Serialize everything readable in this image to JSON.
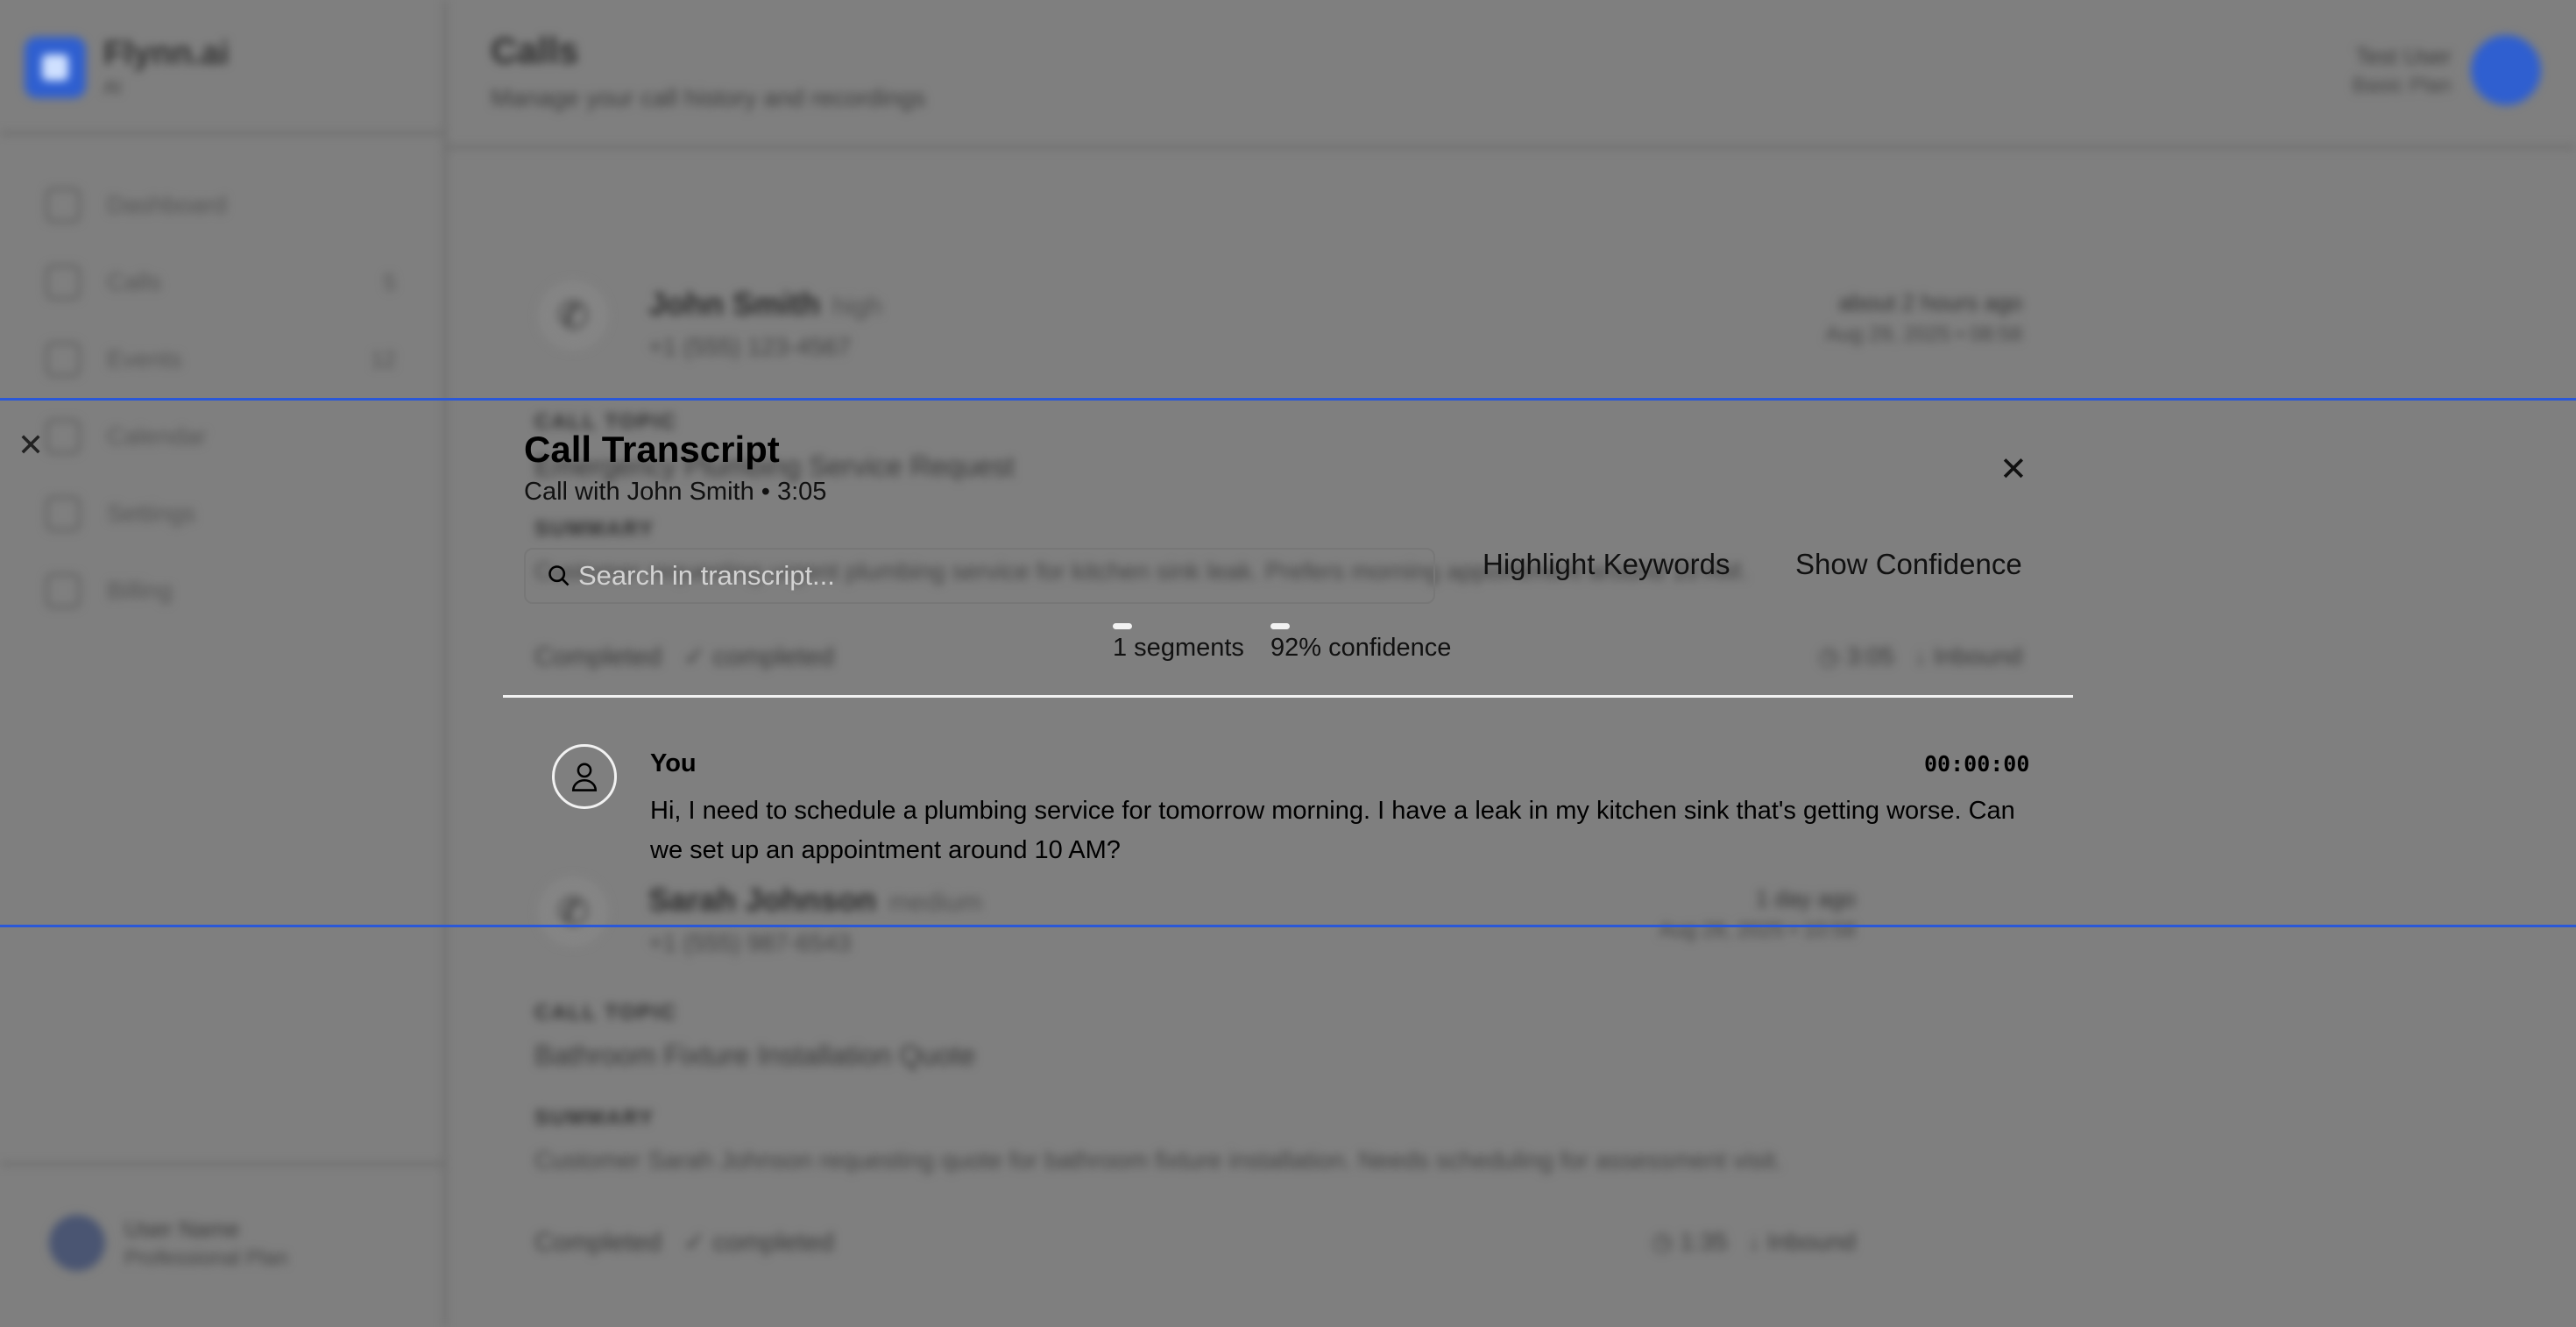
{
  "sidebar": {
    "brand_name": "Flynn.ai",
    "brand_sub": "AI",
    "items": [
      {
        "label": "Dashboard",
        "badge": ""
      },
      {
        "label": "Calls",
        "badge": "5"
      },
      {
        "label": "Events",
        "badge": "12"
      },
      {
        "label": "Calendar",
        "badge": ""
      },
      {
        "label": "Settings",
        "badge": ""
      },
      {
        "label": "Billing",
        "badge": ""
      }
    ],
    "user_name": "User Name",
    "user_plan": "Professional Plan"
  },
  "header": {
    "title": "Calls",
    "subtitle": "Manage your call history and recordings",
    "user_name": "Test User",
    "user_plan": "Basic Plan"
  },
  "calls": [
    {
      "name": "John Smith",
      "tag": "high",
      "phone": "+1 (555) 123-4567",
      "when": "about 2 hours ago",
      "date": "Aug 29, 2025 • 08:58",
      "topic_label": "CALL TOPIC",
      "topic": "Emergency Plumbing Service Request",
      "summary_label": "SUMMARY",
      "summary": "Customer requesting urgent plumbing service for kitchen sink leak. Prefers morning appointment around 10 AM.",
      "status": "Completed",
      "status2": "completed",
      "duration": "3:05",
      "direction": "Inbound"
    },
    {
      "name": "Sarah Johnson",
      "tag": "medium",
      "phone": "+1 (555) 987-6543",
      "when": "1 day ago",
      "date": "Aug 28, 2025 • 10:58",
      "topic_label": "CALL TOPIC",
      "topic": "Bathroom Fixture Installation Quote",
      "summary_label": "SUMMARY",
      "summary": "Customer Sarah Johnson requesting quote for bathroom fixture installation. Needs scheduling for assessment visit.",
      "status": "Completed",
      "status2": "completed",
      "duration": "1:35",
      "direction": "Inbound"
    }
  ],
  "modal": {
    "title": "Call Transcript",
    "subtitle": "Call with John Smith • 3:05",
    "search_placeholder": "Search in transcript...",
    "highlight_label": "Highlight Keywords",
    "confidence_label": "Show Confidence",
    "segments_stat": "1 segments",
    "confidence_stat": "92% confidence",
    "segments": [
      {
        "speaker": "You",
        "time": "00:00:00",
        "text": "Hi, I need to schedule a plumbing service for tomorrow morning. I have a leak in my kitchen sink that's getting worse. Can we set up an appointment around 10 AM?"
      }
    ]
  },
  "icons": {
    "close": "close-icon",
    "search": "search-icon",
    "user": "user-icon",
    "phone": "phone-icon"
  },
  "colors": {
    "overlay": "#7f7f7f",
    "brand_blue": "#2f5fd0",
    "band_border": "#2a58d8"
  }
}
